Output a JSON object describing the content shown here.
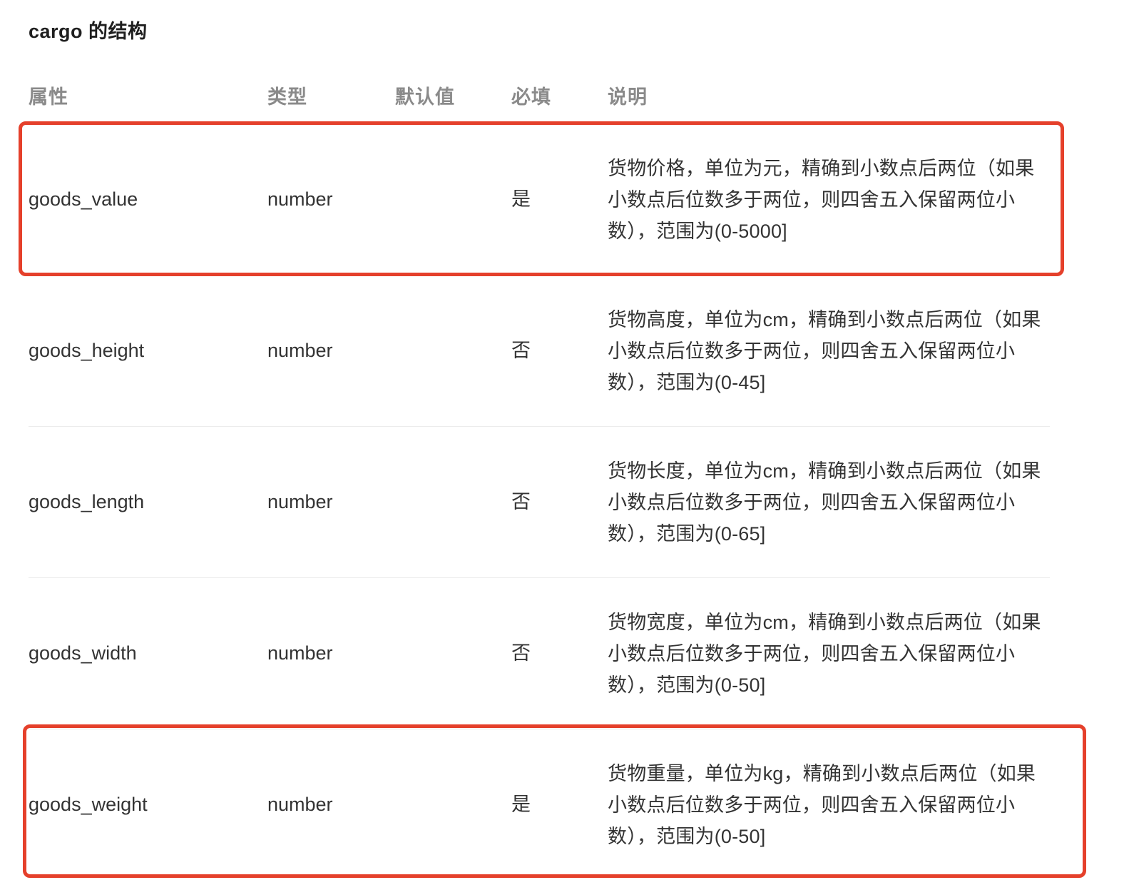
{
  "title": "cargo 的结构",
  "table": {
    "headers": {
      "name": "属性",
      "type": "类型",
      "default": "默认值",
      "required": "必填",
      "description": "说明"
    },
    "rows": [
      {
        "name": "goods_value",
        "type": "number",
        "default": "",
        "required": "是",
        "description": "货物价格，单位为元，精确到小数点后两位（如果小数点后位数多于两位，则四舍五入保留两位小数），范围为(0-5000]",
        "highlighted": true
      },
      {
        "name": "goods_height",
        "type": "number",
        "default": "",
        "required": "否",
        "description": "货物高度，单位为cm，精确到小数点后两位（如果小数点后位数多于两位，则四舍五入保留两位小数），范围为(0-45]",
        "highlighted": false
      },
      {
        "name": "goods_length",
        "type": "number",
        "default": "",
        "required": "否",
        "description": "货物长度，单位为cm，精确到小数点后两位（如果小数点后位数多于两位，则四舍五入保留两位小数），范围为(0-65]",
        "highlighted": false
      },
      {
        "name": "goods_width",
        "type": "number",
        "default": "",
        "required": "否",
        "description": "货物宽度，单位为cm，精确到小数点后两位（如果小数点后位数多于两位，则四舍五入保留两位小数），范围为(0-50]",
        "highlighted": false
      },
      {
        "name": "goods_weight",
        "type": "number",
        "default": "",
        "required": "是",
        "description": "货物重量，单位为kg，精确到小数点后两位（如果小数点后位数多于两位，则四舍五入保留两位小数），范围为(0-50]",
        "highlighted": true
      }
    ]
  },
  "colors": {
    "highlight_border": "#e5402b",
    "header_text": "#8a8a8a",
    "body_text": "#333333",
    "row_divider": "#ececec"
  }
}
